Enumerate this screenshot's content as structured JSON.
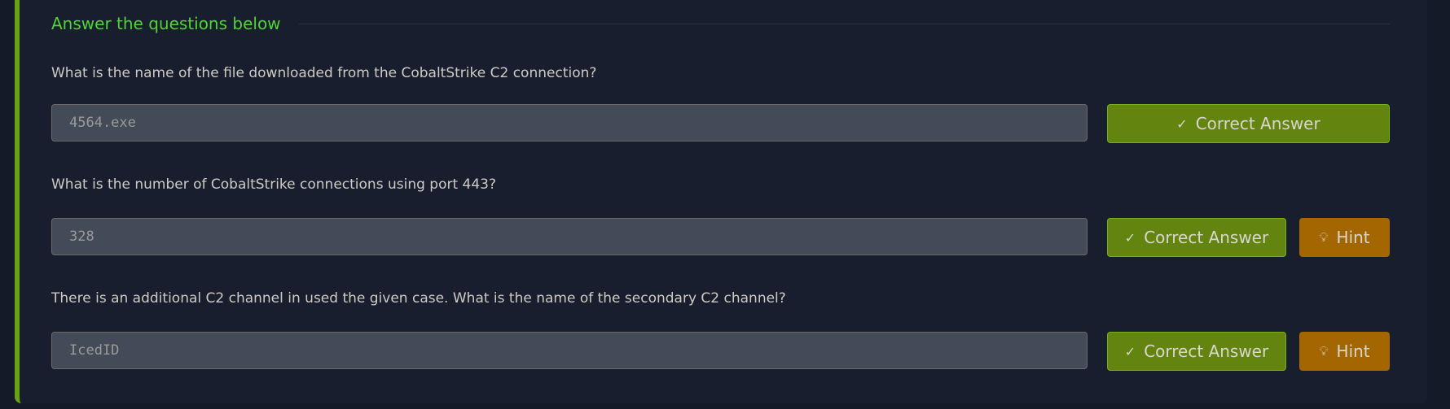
{
  "section": {
    "title": "Answer the questions below"
  },
  "colors": {
    "accent": "#6aa312",
    "title": "#4fd434",
    "correct": "#63840f",
    "hint": "#a36600"
  },
  "questions": [
    {
      "text": "What is the name of the file downloaded from the CobaltStrike C2 connection?",
      "answer": "4564.exe",
      "button": "Correct Answer",
      "hint": null
    },
    {
      "text": "What is the number of CobaltStrike connections using port 443?",
      "answer": "328",
      "button": "Correct Answer",
      "hint": "Hint"
    },
    {
      "text": "There is an additional C2 channel in used the given case. What is the name of the secondary C2 channel?",
      "answer": "IcedID",
      "button": "Correct Answer",
      "hint": "Hint"
    }
  ],
  "icons": {
    "check": "check-icon",
    "hint": "lightbulb-icon"
  }
}
